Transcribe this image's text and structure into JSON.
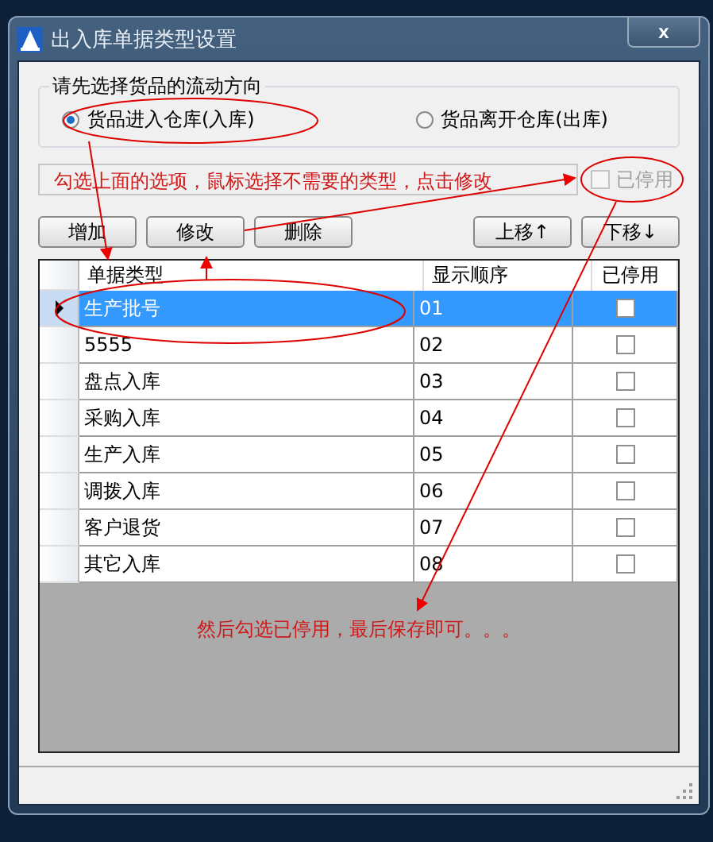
{
  "window": {
    "title": "出入库单据类型设置",
    "close": "x"
  },
  "direction": {
    "legend": "请先选择货品的流动方向",
    "options": [
      {
        "label": "货品进入仓库(入库)",
        "selected": true
      },
      {
        "label": "货品离开仓库(出库)",
        "selected": false
      }
    ]
  },
  "disabled_checkbox": {
    "label": "已停用",
    "checked": false,
    "disabled": true
  },
  "buttons_left": [
    "增加",
    "修改",
    "删除"
  ],
  "buttons_right": [
    "上移↑",
    "下移↓"
  ],
  "table": {
    "columns": [
      "单据类型",
      "显示顺序",
      "已停用"
    ],
    "rows": [
      {
        "type": "生产批号",
        "order": "01",
        "disabled": false,
        "selected": true
      },
      {
        "type": "5555",
        "order": "02",
        "disabled": false,
        "selected": false
      },
      {
        "type": "盘点入库",
        "order": "03",
        "disabled": false,
        "selected": false
      },
      {
        "type": "采购入库",
        "order": "04",
        "disabled": false,
        "selected": false
      },
      {
        "type": "生产入库",
        "order": "05",
        "disabled": false,
        "selected": false
      },
      {
        "type": "调拨入库",
        "order": "06",
        "disabled": false,
        "selected": false
      },
      {
        "type": "客户退货",
        "order": "07",
        "disabled": false,
        "selected": false
      },
      {
        "type": "其它入库",
        "order": "08",
        "disabled": false,
        "selected": false
      }
    ]
  },
  "annotations": [
    "勾选上面的选项，鼠标选择不需要的类型，点击修改",
    "然后勾选已停用，最后保存即可。。。"
  ]
}
